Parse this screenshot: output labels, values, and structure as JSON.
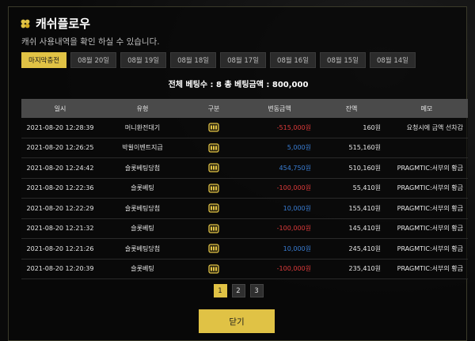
{
  "header": {
    "title": "캐쉬플로우",
    "subtitle": "캐쉬 사용내역을 확인 하실 수 있습니다."
  },
  "tabs": [
    {
      "label": "마지막충전",
      "active": true
    },
    {
      "label": "08월 20일",
      "active": false
    },
    {
      "label": "08월 19일",
      "active": false
    },
    {
      "label": "08월 18일",
      "active": false
    },
    {
      "label": "08월 17일",
      "active": false
    },
    {
      "label": "08월 16일",
      "active": false
    },
    {
      "label": "08월 15일",
      "active": false
    },
    {
      "label": "08월 14일",
      "active": false
    }
  ],
  "summary": "전체 베팅수 : 8   총 베팅금액 : 800,000",
  "table": {
    "columns": [
      "일시",
      "유형",
      "구분",
      "변동금액",
      "잔액",
      "메모"
    ],
    "rows": [
      {
        "datetime": "2021-08-20 12:28:39",
        "type": "머니환전대기",
        "amount": "-515,000원",
        "amount_sign": "neg",
        "balance": "160원",
        "memo": "요청시에 금액 선차감"
      },
      {
        "datetime": "2021-08-20 12:26:25",
        "type": "박윌이벤트지급",
        "amount": "5,000원",
        "amount_sign": "pos",
        "balance": "515,160원",
        "memo": ""
      },
      {
        "datetime": "2021-08-20 12:24:42",
        "type": "슬롯베팅당첨",
        "amount": "454,750원",
        "amount_sign": "pos",
        "balance": "510,160원",
        "memo": "PRAGMTIC:서부의 황금"
      },
      {
        "datetime": "2021-08-20 12:22:36",
        "type": "슬롯베팅",
        "amount": "-100,000원",
        "amount_sign": "neg",
        "balance": "55,410원",
        "memo": "PRAGMTIC:서부의 황금"
      },
      {
        "datetime": "2021-08-20 12:22:29",
        "type": "슬롯베팅당첨",
        "amount": "10,000원",
        "amount_sign": "pos",
        "balance": "155,410원",
        "memo": "PRAGMTIC:서부의 황금"
      },
      {
        "datetime": "2021-08-20 12:21:32",
        "type": "슬롯베팅",
        "amount": "-100,000원",
        "amount_sign": "neg",
        "balance": "145,410원",
        "memo": "PRAGMTIC:서부의 황금"
      },
      {
        "datetime": "2021-08-20 12:21:26",
        "type": "슬롯베팅당첨",
        "amount": "10,000원",
        "amount_sign": "pos",
        "balance": "245,410원",
        "memo": "PRAGMTIC:서부의 황금"
      },
      {
        "datetime": "2021-08-20 12:20:39",
        "type": "슬롯베팅",
        "amount": "-100,000원",
        "amount_sign": "neg",
        "balance": "235,410원",
        "memo": "PRAGMTIC:서부의 황금"
      }
    ]
  },
  "pagination": {
    "pages": [
      "1",
      "2",
      "3"
    ],
    "current": "1"
  },
  "close_label": "닫기",
  "colors": {
    "accent": "#e0c245",
    "negative": "#e03b3b",
    "positive": "#3a7fd6"
  },
  "icons": {
    "title": "clover-icon",
    "category": "slot-machine-icon"
  }
}
